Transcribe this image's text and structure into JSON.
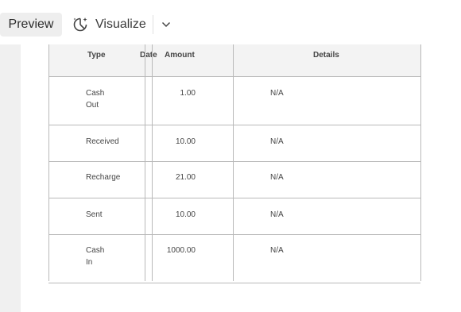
{
  "toolbar": {
    "preview_label": "Preview",
    "visualize_label": "Visualize",
    "icons": {
      "visualize": "sparkle-chart-icon",
      "dropdown": "chevron-down-icon"
    }
  },
  "table": {
    "headers": {
      "type": "Type",
      "date": "Date",
      "amount": "Amount",
      "details": "Details"
    },
    "rows": [
      {
        "type": "Cash Out",
        "date": "",
        "amount": "1.00",
        "details": "N/A"
      },
      {
        "type": "Received",
        "date": "",
        "amount": "10.00",
        "details": "N/A"
      },
      {
        "type": "Recharge",
        "date": "",
        "amount": "21.00",
        "details": "N/A"
      },
      {
        "type": "Sent",
        "date": "",
        "amount": "10.00",
        "details": "N/A"
      },
      {
        "type": "Cash In",
        "date": "",
        "amount": "1000.00",
        "details": "N/A"
      }
    ]
  },
  "colors": {
    "border": "#b9b9b9",
    "header_bg": "#f3f3f3",
    "sidebar_bg": "#f0f0f0"
  }
}
